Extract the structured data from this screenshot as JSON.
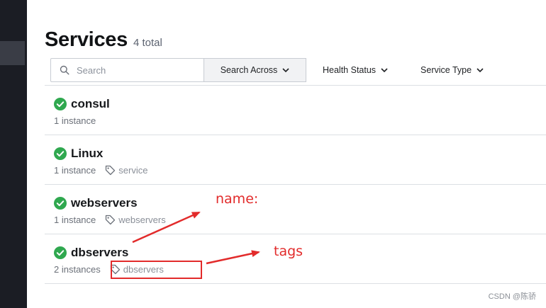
{
  "page": {
    "title": "Services",
    "count": "4 total"
  },
  "filters": {
    "search_placeholder": "Search",
    "search_across": "Search Across",
    "health_status": "Health Status",
    "service_type": "Service Type"
  },
  "services": [
    {
      "name": "consul",
      "instances": "1 instance",
      "tag": ""
    },
    {
      "name": "Linux",
      "instances": "1 instance",
      "tag": "service"
    },
    {
      "name": "webservers",
      "instances": "1 instance",
      "tag": "webservers"
    },
    {
      "name": "dbservers",
      "instances": "2 instances",
      "tag": "dbservers"
    }
  ],
  "annotations": {
    "name_label": "name:",
    "tags_label": "tags"
  },
  "watermark": "CSDN @陈骄",
  "colors": {
    "healthy": "#2fa84f",
    "annotation": "#e22b2b",
    "sidebar": "#1b1d24"
  }
}
